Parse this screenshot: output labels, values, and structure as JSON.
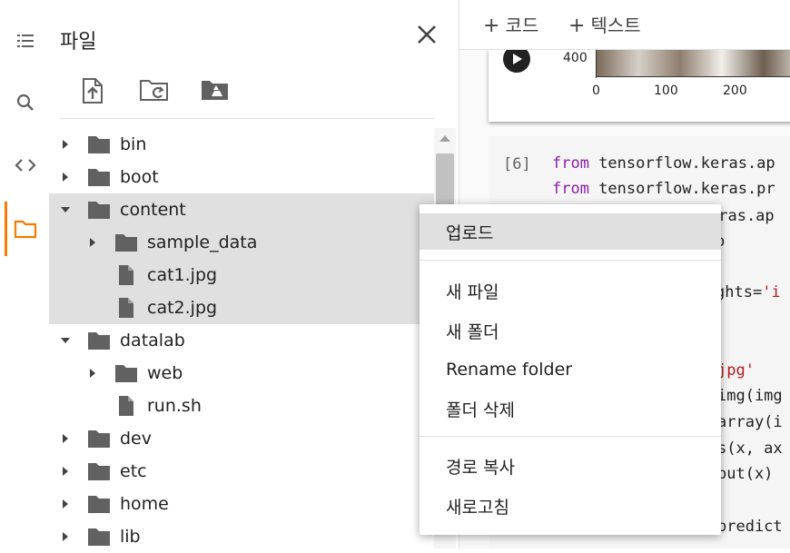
{
  "rail": {
    "items": [
      {
        "icon": "toc-icon",
        "active": false
      },
      {
        "icon": "search-icon",
        "active": false
      },
      {
        "icon": "code-icon",
        "active": false
      },
      {
        "icon": "folder-icon",
        "active": true
      }
    ],
    "accent_color": "#f57c00"
  },
  "panel": {
    "title": "파일",
    "toolbar": [
      {
        "icon": "upload-file-icon"
      },
      {
        "icon": "refresh-folder-icon"
      },
      {
        "icon": "mount-drive-icon"
      }
    ]
  },
  "tree": [
    {
      "name": "bin",
      "type": "folder",
      "depth": 0,
      "expanded": false,
      "selected": false
    },
    {
      "name": "boot",
      "type": "folder",
      "depth": 0,
      "expanded": false,
      "selected": false
    },
    {
      "name": "content",
      "type": "folder",
      "depth": 0,
      "expanded": true,
      "selected": true
    },
    {
      "name": "sample_data",
      "type": "folder",
      "depth": 1,
      "expanded": false,
      "selected": true
    },
    {
      "name": "cat1.jpg",
      "type": "file",
      "depth": 1,
      "selected": true
    },
    {
      "name": "cat2.jpg",
      "type": "file",
      "depth": 1,
      "selected": true
    },
    {
      "name": "datalab",
      "type": "folder",
      "depth": 0,
      "expanded": true,
      "selected": false
    },
    {
      "name": "web",
      "type": "folder",
      "depth": 1,
      "expanded": false,
      "selected": false
    },
    {
      "name": "run.sh",
      "type": "file",
      "depth": 1,
      "selected": false
    },
    {
      "name": "dev",
      "type": "folder",
      "depth": 0,
      "expanded": false,
      "selected": false
    },
    {
      "name": "etc",
      "type": "folder",
      "depth": 0,
      "expanded": false,
      "selected": false
    },
    {
      "name": "home",
      "type": "folder",
      "depth": 0,
      "expanded": false,
      "selected": false
    },
    {
      "name": "lib",
      "type": "folder",
      "depth": 0,
      "expanded": false,
      "selected": false
    }
  ],
  "notebook": {
    "add_code": "코드",
    "add_text": "텍스트",
    "plus": "+",
    "output_axis": {
      "y_tick": "400",
      "x_ticks": [
        "0",
        "100",
        "200"
      ]
    },
    "execution_count": "[6]",
    "code_lines": [
      {
        "kw": "from",
        "text": " tensorflow.keras.ap",
        "str": ""
      },
      {
        "kw": "from",
        "text": " tensorflow.keras.pr",
        "str": ""
      },
      {
        "kw": "",
        "text": "eras.ap",
        "str": ""
      },
      {
        "kw": "",
        "text": "p",
        "str": ""
      },
      {
        "kw": "",
        "text": "ghts=",
        "str": "'i"
      },
      {
        "kw": "",
        "text": "",
        "str": "jpg'"
      },
      {
        "kw": "",
        "text": "img(img",
        "str": ""
      },
      {
        "kw": "",
        "text": "array(i",
        "str": ""
      },
      {
        "kw": "",
        "text": "s(x, ax",
        "str": ""
      },
      {
        "kw": "",
        "text": "put(x)",
        "str": ""
      },
      {
        "kw": "",
        "text": "predict",
        "str": ""
      }
    ]
  },
  "context_menu": {
    "items": [
      {
        "label": "업로드",
        "highlighted": true
      },
      {
        "label": "새 파일",
        "highlighted": false
      },
      {
        "label": "새 폴더",
        "highlighted": false
      },
      {
        "label": "Rename folder",
        "highlighted": false
      },
      {
        "label": "폴더 삭제",
        "highlighted": false
      },
      {
        "label": "경로 복사",
        "highlighted": false
      },
      {
        "label": "새로고침",
        "highlighted": false
      }
    ]
  }
}
